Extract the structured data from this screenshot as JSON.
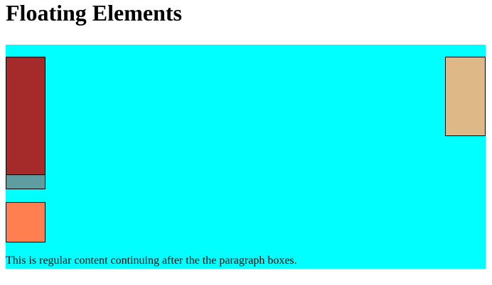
{
  "page": {
    "title": "Floating Elements",
    "content_text": "This is regular content continuing after the the paragraph boxes."
  },
  "colors": {
    "container_background": "#00ffff",
    "box_brown": "#a52a2a",
    "box_teal": "#5f9ea0",
    "box_coral": "#ff7f50",
    "box_tan": "#deb887",
    "border": "#000000"
  }
}
